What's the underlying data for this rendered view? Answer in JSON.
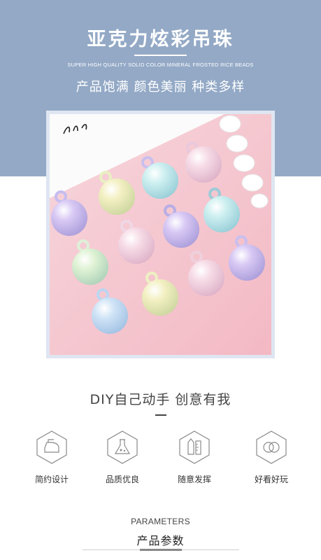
{
  "header": {
    "title": "亚克力炫彩吊珠",
    "subtitle_en": "SUPER HIGH QUALITY SOLID COLOR MINERAL FROSTED RICE BEADS",
    "tagline": "产品饱满 颜色美丽 种类多样",
    "background_color": "#93a9c6"
  },
  "section_diy": {
    "heading": "DIY自己动手 创意有我"
  },
  "features": [
    {
      "label": "简约设计",
      "icon": "iron-icon"
    },
    {
      "label": "品质优良",
      "icon": "flask-icon"
    },
    {
      "label": "随意发挥",
      "icon": "ruler-pencil-icon"
    },
    {
      "label": "好看好玩",
      "icon": "rings-icon"
    }
  ],
  "parameters": {
    "heading_en": "PARAMETERS",
    "heading_zh": "产品参数"
  },
  "colors": {
    "icon_stroke": "#8a8a8a",
    "text_dark": "#333333"
  }
}
